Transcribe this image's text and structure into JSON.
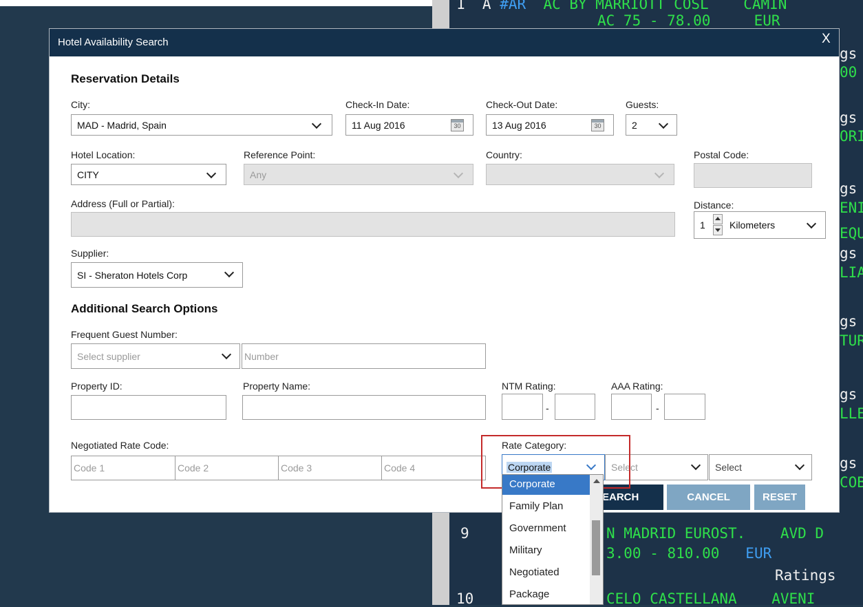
{
  "dialog": {
    "title": "Hotel Availability Search",
    "close": "X"
  },
  "sections": {
    "reservation": "Reservation Details",
    "additional": "Additional Search Options"
  },
  "city": {
    "label": "City:",
    "value": "MAD - Madrid, Spain"
  },
  "checkin": {
    "label": "Check-In Date:",
    "value": "11 Aug 2016",
    "icon_text": "30"
  },
  "checkout": {
    "label": "Check-Out Date:",
    "value": "13 Aug 2016",
    "icon_text": "30"
  },
  "guests": {
    "label": "Guests:",
    "value": "2"
  },
  "hotel_location": {
    "label": "Hotel Location:",
    "value": "CITY"
  },
  "reference_point": {
    "label": "Reference Point:",
    "value": "Any"
  },
  "country": {
    "label": "Country:",
    "value": ""
  },
  "postal": {
    "label": "Postal Code:",
    "value": ""
  },
  "address": {
    "label": "Address (Full or Partial):",
    "value": ""
  },
  "distance": {
    "label": "Distance:",
    "value": "1",
    "unit": "Kilometers"
  },
  "supplier": {
    "label": "Supplier:",
    "value": "SI - Sheraton Hotels Corp"
  },
  "frequent_guest": {
    "label": "Frequent Guest Number:",
    "supplier_placeholder": "Select supplier",
    "number_placeholder": "Number"
  },
  "property_id": {
    "label": "Property ID:"
  },
  "property_name": {
    "label": "Property Name:"
  },
  "ntm": {
    "label": "NTM Rating:",
    "sep": "-"
  },
  "aaa": {
    "label": "AAA Rating:",
    "sep": "-"
  },
  "negotiated": {
    "label": "Negotiated Rate Code:",
    "codes": [
      "Code 1",
      "Code 2",
      "Code 3",
      "Code 4"
    ]
  },
  "rate_category": {
    "label": "Rate Category:",
    "value": "Corporate",
    "select2": "Select",
    "select3": "Select",
    "options": [
      "Corporate",
      "Family Plan",
      "Government",
      "Military",
      "Negotiated",
      "Package"
    ]
  },
  "buttons": {
    "search": "SEARCH",
    "search_visible": "EARCH",
    "cancel": "CANCEL",
    "reset": "RESET"
  },
  "colors": {
    "header": "#14304b",
    "search_btn": "#14304b",
    "secondary_btn": "#7fa6c3",
    "highlight": "#c42a2a",
    "selection": "#3879c7"
  },
  "terminal": {
    "line1": {
      "a": "1  A ",
      "b": "#AR",
      "c": "  AC BY MARRIOTT COSL    CAMIN"
    },
    "line2": "AC 75 - 78.00     EUR",
    "right_fragments": [
      "gs",
      "00",
      "gs",
      "ORI",
      "gs",
      "ENI",
      "EQU",
      "gs",
      "LIA",
      "gs",
      "TUR",
      "gs",
      "LLE",
      "gs",
      "COB"
    ],
    "line9a": {
      "num": "9",
      "text": "N MADRID EUROST.    AVD D"
    },
    "line9b": {
      "text": "3.00 - 810.00   ",
      "cur": "EUR"
    },
    "ratings": "Ratings",
    "line10": {
      "num": "10",
      "text": "CELO CASTELLANA    AVENI"
    }
  }
}
